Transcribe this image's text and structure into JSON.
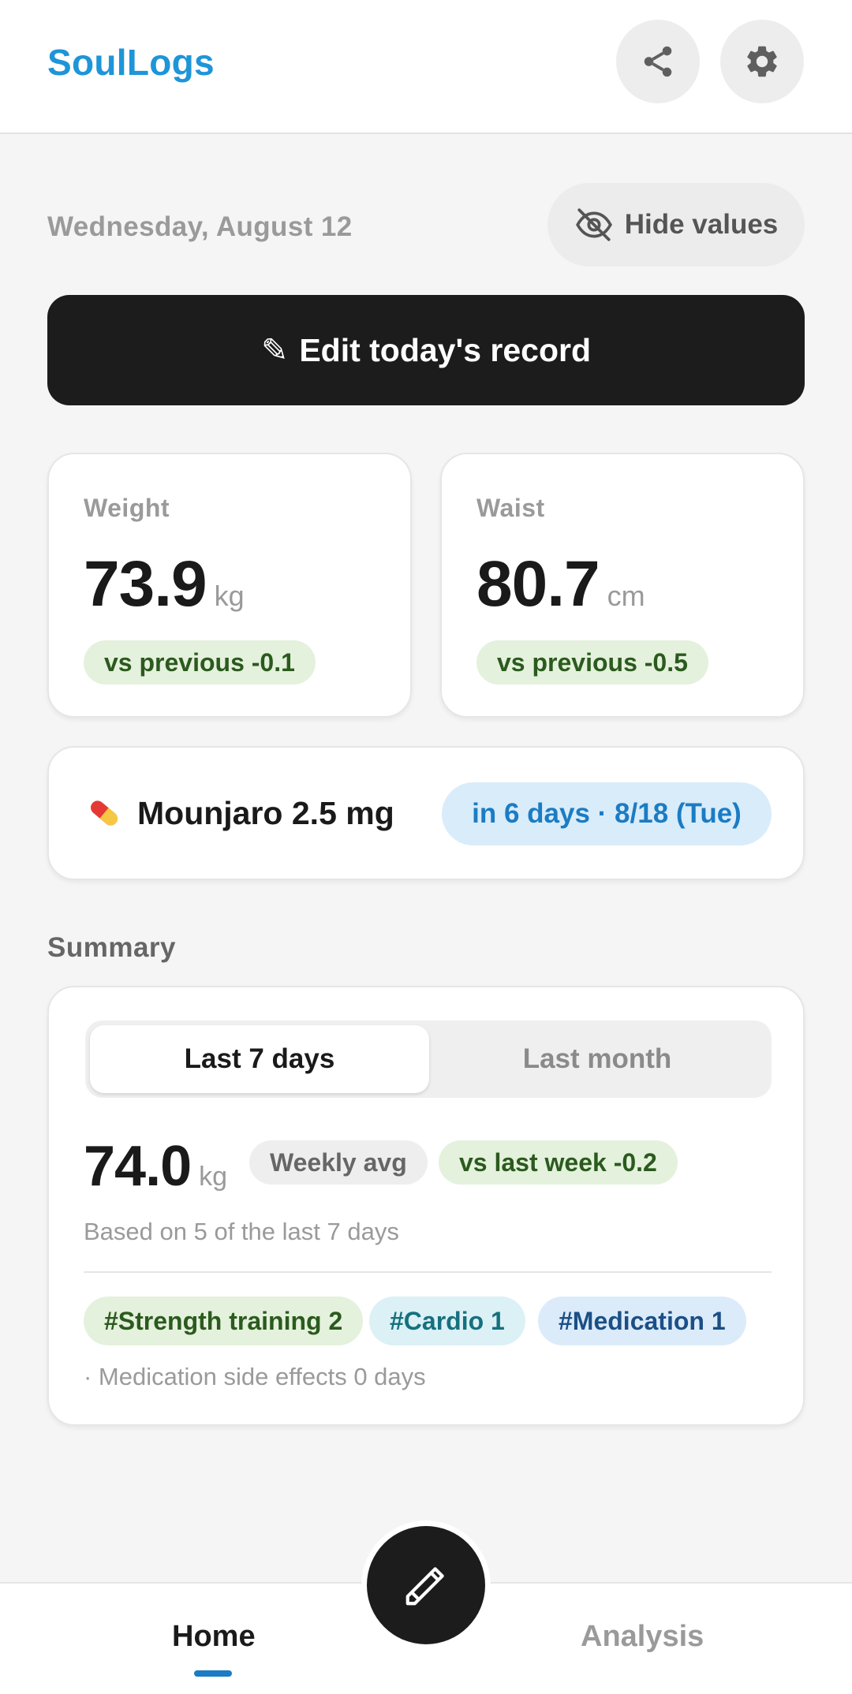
{
  "header": {
    "brand": "SoulLogs",
    "share_icon": "share-icon",
    "settings_icon": "gear-icon"
  },
  "date_row": {
    "date": "Wednesday, August 12",
    "hide_values_label": "Hide values",
    "hide_icon": "eye-off-icon"
  },
  "edit_button": {
    "icon": "✎",
    "label": "Edit today's record"
  },
  "metrics": {
    "weight": {
      "label": "Weight",
      "value": "73.9",
      "unit": "kg",
      "delta": "vs previous -0.1"
    },
    "waist": {
      "label": "Waist",
      "value": "80.7",
      "unit": "cm",
      "delta": "vs previous -0.5"
    }
  },
  "medication": {
    "icon": "💊",
    "name": "Mounjaro 2.5 mg",
    "next": "in 6 days · 8/18 (Tue)"
  },
  "summary": {
    "title": "Summary",
    "tabs": [
      {
        "label": "Last 7 days",
        "active": true
      },
      {
        "label": "Last month",
        "active": false
      }
    ],
    "avg_value": "74.0",
    "avg_unit": "kg",
    "avg_badge": "Weekly avg",
    "delta_badge": "vs last week -0.2",
    "based_on": "Based on 5 of the last 7 days",
    "tags": [
      "#Strength training 2",
      "#Cardio 1",
      "#Medication 1"
    ],
    "side_effects": "· Medication side effects 0 days"
  },
  "bottom_nav": {
    "home_label": "Home",
    "analysis_label": "Analysis",
    "fab_icon": "pencil-icon"
  },
  "colors": {
    "brand": "#1e95d8",
    "accent_blue": "#1b7cc4",
    "dark": "#1c1c1c",
    "positive_bg": "#e4f1dc",
    "positive_text": "#2b5a1e"
  }
}
